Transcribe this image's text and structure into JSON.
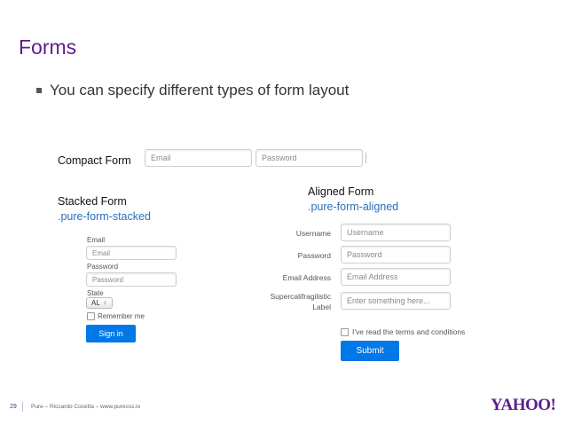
{
  "slide": {
    "title": "Forms",
    "bullet": "You can specify different types of form layout"
  },
  "compact": {
    "label": "Compact Form",
    "email_placeholder": "Email",
    "password_placeholder": "Password"
  },
  "stacked": {
    "label": "Stacked Form",
    "class_name": ".pure-form-stacked",
    "email_label": "Email",
    "email_placeholder": "Email",
    "password_label": "Password",
    "password_placeholder": "Password",
    "state_label": "State",
    "state_value": "AL",
    "remember_label": "Remember me",
    "signin_label": "Sign in"
  },
  "aligned": {
    "label": "Aligned Form",
    "class_name": ".pure-form-aligned",
    "username_label": "Username",
    "username_placeholder": "Username",
    "password_label": "Password",
    "password_placeholder": "Password",
    "email_label": "Email Address",
    "email_placeholder": "Email Address",
    "super_label_1": "Supercalifragilistic",
    "super_label_2": "Label",
    "super_placeholder": "Enter something here...",
    "terms_label": "I've read the terms and conditions",
    "submit_label": "Submit"
  },
  "footer": {
    "page_number": "29",
    "text": "Pure – Riccardo Cocetta – www.purecss.io",
    "logo": "YAHOO!"
  },
  "colors": {
    "brand_purple": "#5d1e8c",
    "link_blue": "#2a6fbd",
    "button_blue": "#0078e7"
  }
}
